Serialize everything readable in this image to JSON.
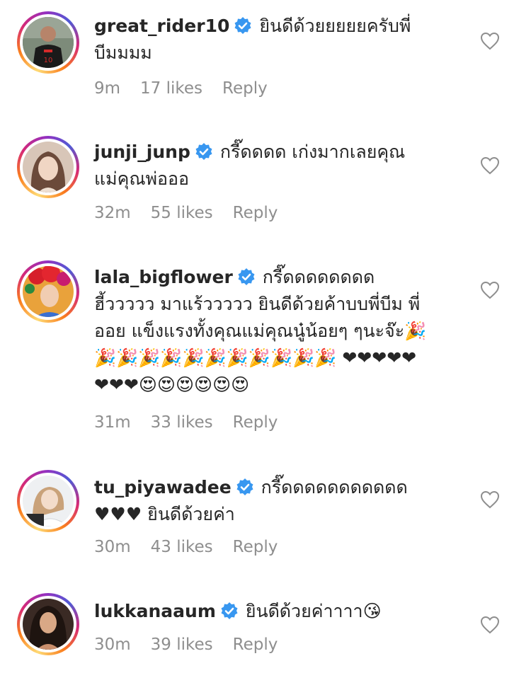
{
  "colors": {
    "verified": "#3897f0",
    "meta": "#8e8e8e",
    "text": "#262626"
  },
  "comments": [
    {
      "username": "great_rider10",
      "text": "ยินดีด้วยยยยยครับพี่บีมมมม",
      "time": "9m",
      "likes": "17 likes",
      "reply": "Reply",
      "avatar": "soccer-player"
    },
    {
      "username": "junji_junp",
      "text": "กรี๊ดดดด เก่งมากเลยคุณแม่คุณพ่อออ",
      "time": "32m",
      "likes": "55 likes",
      "reply": "Reply",
      "avatar": "woman-portrait"
    },
    {
      "username": "lala_bigflower",
      "text": "กรี๊ดดดดดดดด ฮี้ววววว มาแร้ววววว ยินดีด้วยค้าบบพี่บีม พี่ออย แข็งแรงทั้งคุณแม่คุณนู๋น้อยๆ ๆนะจ๊ะ🎉🎉🎉🎉🎉🎉🎉🎉🎉🎉🎉🎉 ❤❤❤❤❤❤❤❤😍😍😍😍😍😍",
      "time": "31m",
      "likes": "33 likes",
      "reply": "Reply",
      "avatar": "flower-headdress"
    },
    {
      "username": "tu_piyawadee",
      "text": "กรี๊ดดดดดดดดดดด ♥♥♥ ยินดีด้วยค่า",
      "time": "30m",
      "likes": "43 likes",
      "reply": "Reply",
      "avatar": "woman-light"
    },
    {
      "username": "lukkanaaum",
      "text": "ยินดีด้วยค่าาาา😘",
      "time": "30m",
      "likes": "39 likes",
      "reply": "Reply",
      "avatar": "woman-dark-hair"
    }
  ]
}
